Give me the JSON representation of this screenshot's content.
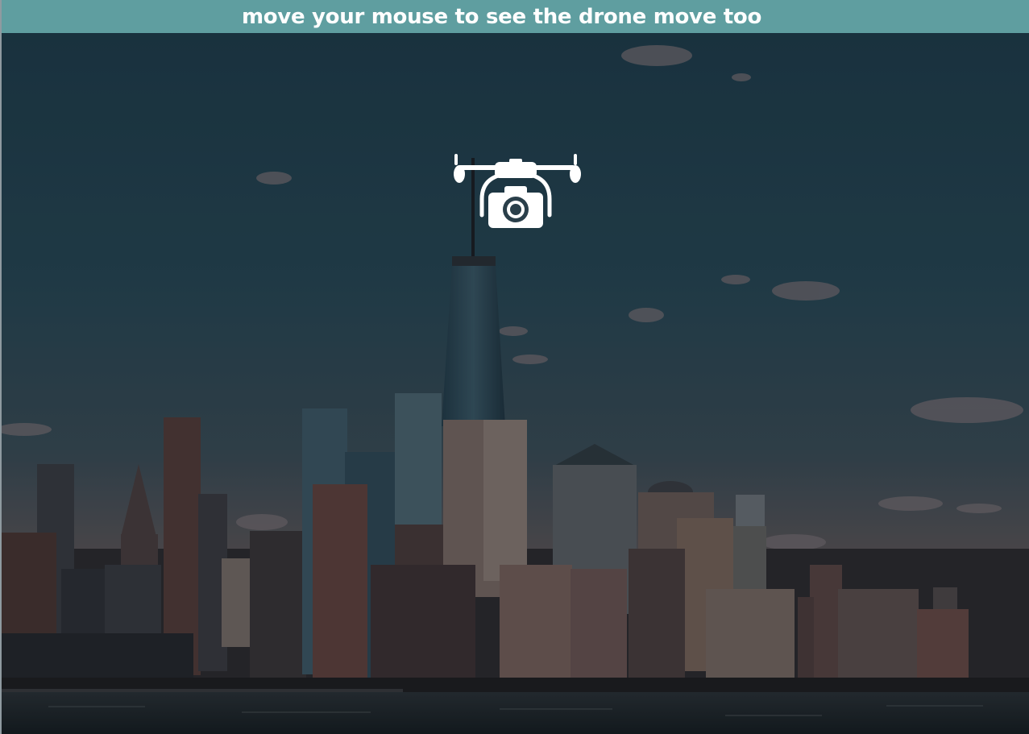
{
  "header": {
    "title": "move your mouse to see the drone move too"
  },
  "drone": {
    "icon": "drone-camera-icon",
    "color": "#ffffff"
  },
  "colors": {
    "header_bg": "#5f9ea0",
    "sky_top": "#1e3b48",
    "sky_bottom": "#8a6a63",
    "water": "#1a2327"
  }
}
